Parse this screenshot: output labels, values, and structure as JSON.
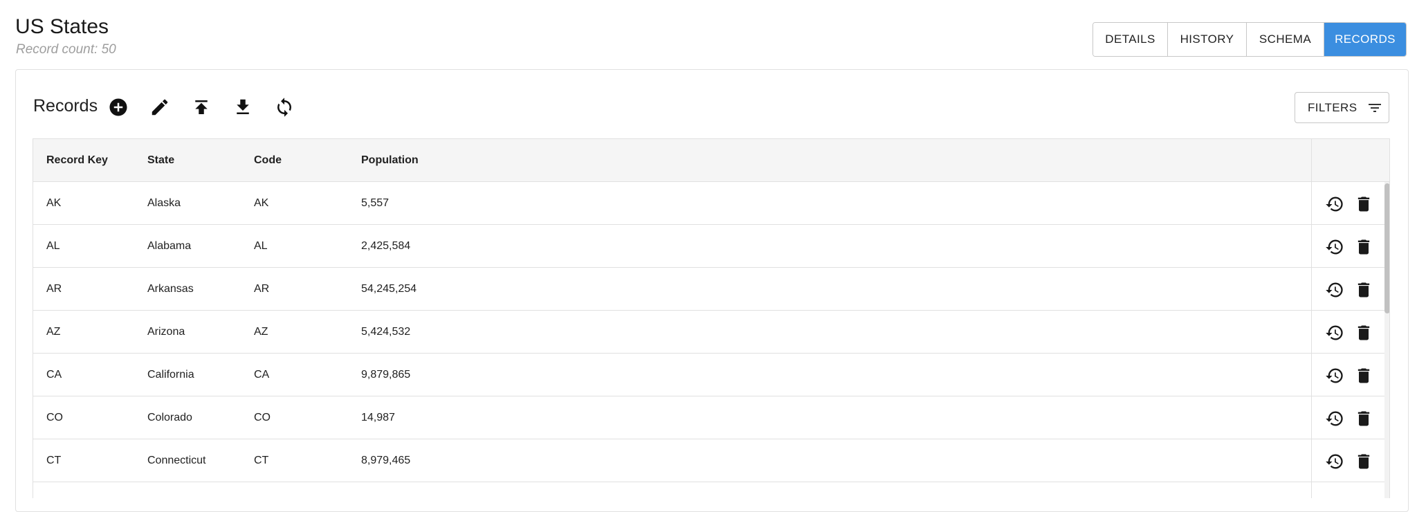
{
  "header": {
    "title": "US States",
    "record_count": "Record count: 50"
  },
  "tabs": [
    {
      "label": "DETAILS",
      "active": false
    },
    {
      "label": "HISTORY",
      "active": false
    },
    {
      "label": "SCHEMA",
      "active": false
    },
    {
      "label": "RECORDS",
      "active": true
    }
  ],
  "toolbar": {
    "title": "Records",
    "icons": [
      "add-circle-icon",
      "edit-pencil-icon",
      "upload-icon",
      "download-icon",
      "refresh-icon"
    ],
    "filters_label": "FILTERS",
    "filters_icon": "filter-list-icon"
  },
  "table": {
    "columns": [
      "Record Key",
      "State",
      "Code",
      "Population"
    ],
    "rows": [
      {
        "key": "AK",
        "state": "Alaska",
        "code": "AK",
        "population": "5,557"
      },
      {
        "key": "AL",
        "state": "Alabama",
        "code": "AL",
        "population": "2,425,584"
      },
      {
        "key": "AR",
        "state": "Arkansas",
        "code": "AR",
        "population": "54,245,254"
      },
      {
        "key": "AZ",
        "state": "Arizona",
        "code": "AZ",
        "population": "5,424,532"
      },
      {
        "key": "CA",
        "state": "California",
        "code": "CA",
        "population": "9,879,865"
      },
      {
        "key": "CO",
        "state": "Colorado",
        "code": "CO",
        "population": "14,987"
      },
      {
        "key": "CT",
        "state": "Connecticut",
        "code": "CT",
        "population": "8,979,465"
      }
    ],
    "row_actions": [
      "history-icon",
      "delete-icon"
    ]
  },
  "colors": {
    "accent": "#3b8ee0",
    "header_bg": "#f5f5f5",
    "border": "#e0e0e0"
  }
}
